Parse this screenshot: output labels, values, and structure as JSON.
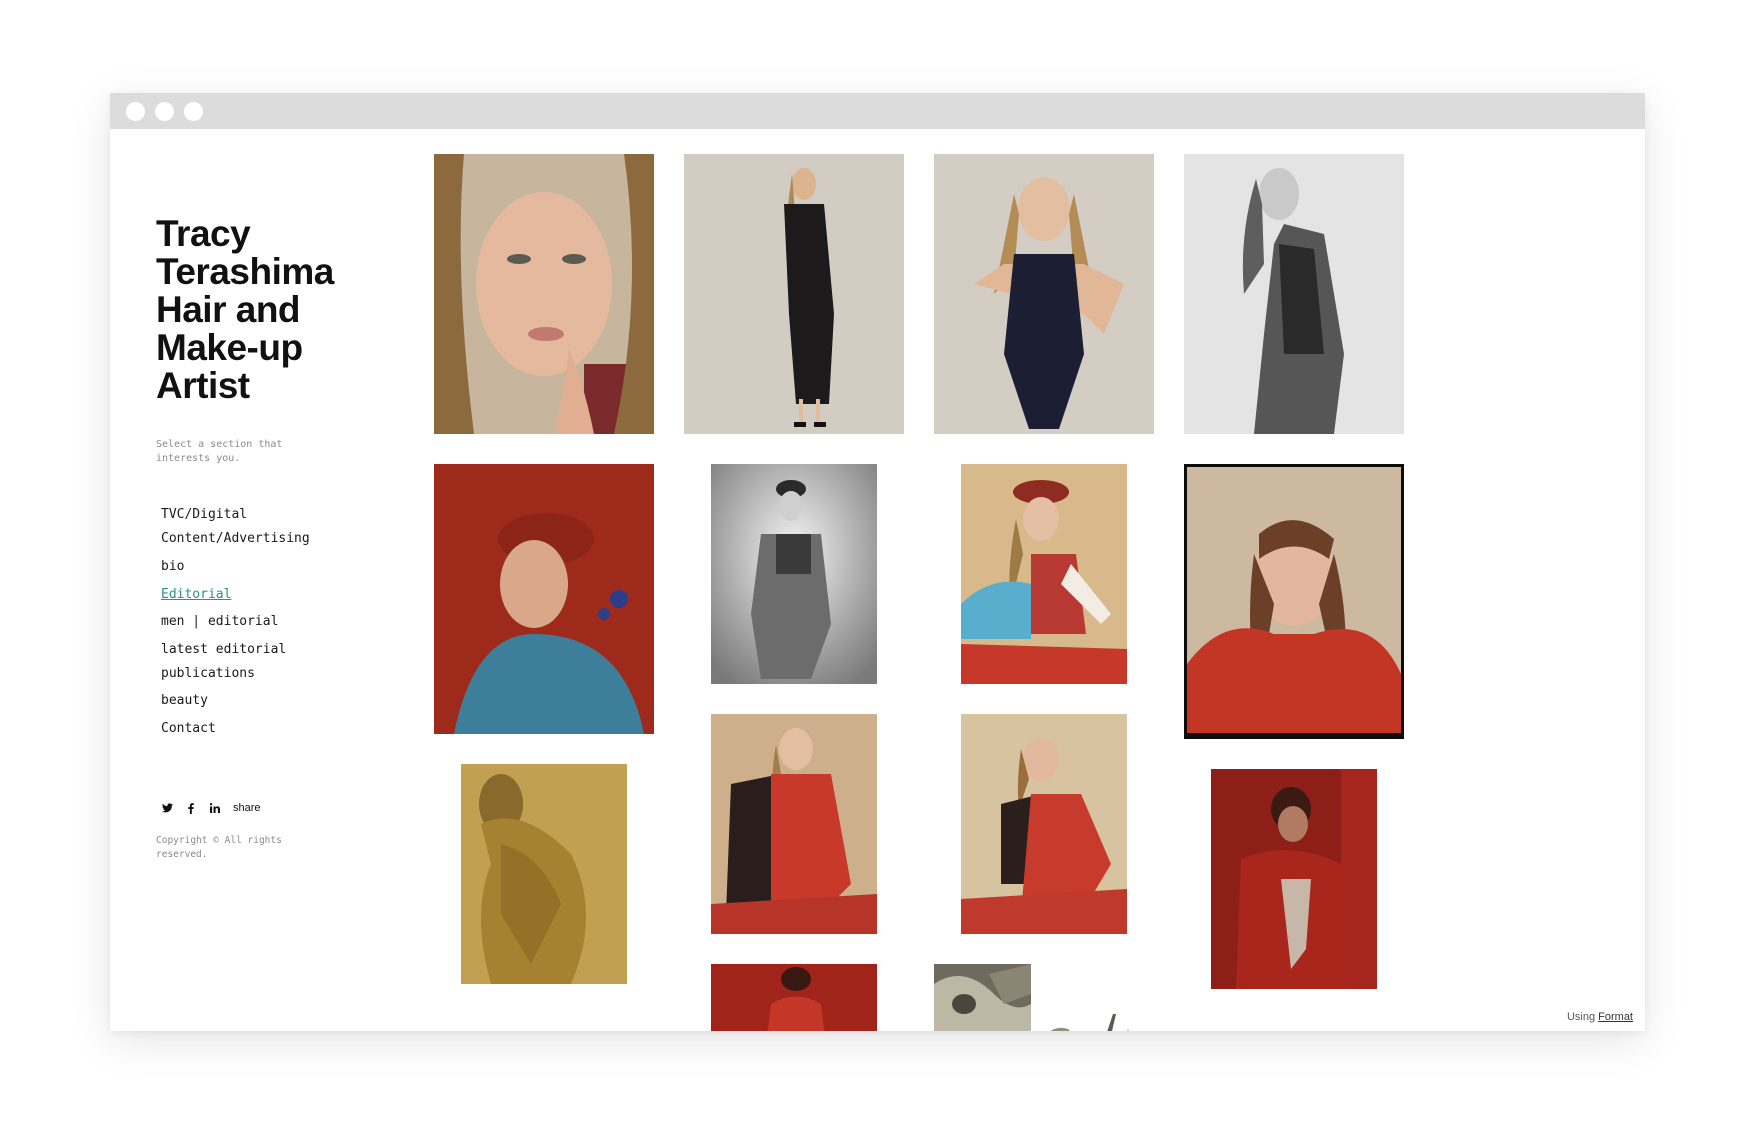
{
  "site": {
    "title_lines": [
      "Tracy",
      "Terashima",
      "Hair and",
      "Make-up",
      "Artist"
    ],
    "tagline": "Select a section that interests you.",
    "copyright": "Copyright © All rights reserved."
  },
  "nav": {
    "items": [
      {
        "label": "TVC/Digital"
      },
      {
        "label": "Content/Advertising"
      },
      {
        "label": "bio"
      },
      {
        "label": "Editorial",
        "active": true
      },
      {
        "label": "men | editorial"
      },
      {
        "label": "latest editorial"
      },
      {
        "label": "publications"
      },
      {
        "label": "beauty"
      },
      {
        "label": "Contact"
      }
    ]
  },
  "social": {
    "icons": [
      "twitter-icon",
      "facebook-icon",
      "linkedin-icon"
    ],
    "share_label": "share"
  },
  "footer": {
    "prefix": "Using",
    "link": "Format"
  },
  "colors": {
    "active_link": "#2a9187",
    "titlebar": "#dcdcdc"
  }
}
